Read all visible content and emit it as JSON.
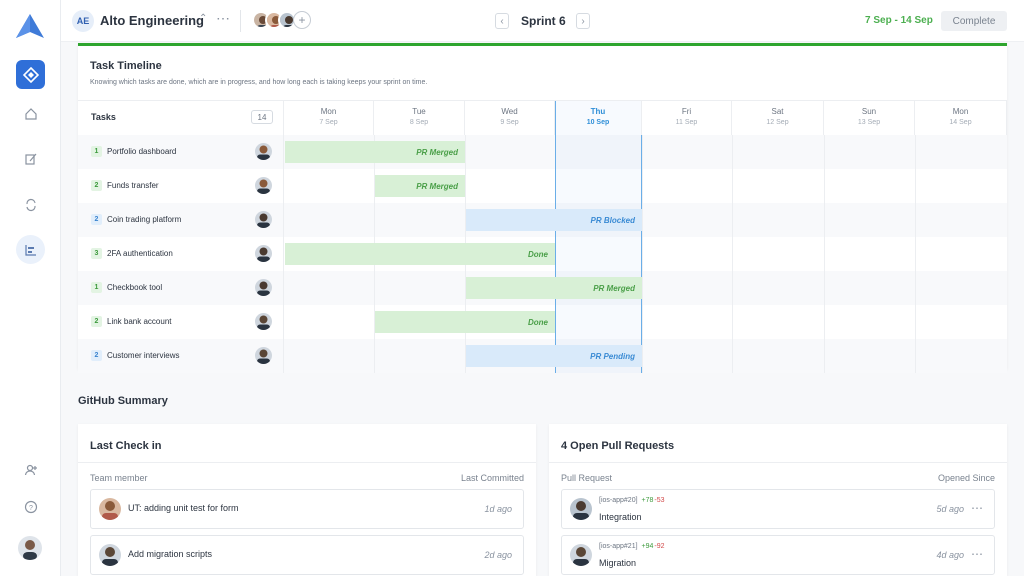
{
  "header": {
    "workspace_initials": "AE",
    "workspace_name": "Alto Engineering",
    "switch_icon": "⌃",
    "more_icon": "⋯",
    "add_member_icon": "+",
    "prev_icon": "‹",
    "next_icon": "›",
    "sprint_name": "Sprint 6",
    "date_range": "7 Sep - 14 Sep",
    "complete_label": "Complete"
  },
  "sidebar": {
    "icons": [
      "logo-icon",
      "sprint-board-icon",
      "home-icon",
      "edit-icon",
      "sync-icon",
      "timeline-icon",
      "add-user-icon",
      "help-icon",
      "user-avatar"
    ]
  },
  "timeline": {
    "title": "Task Timeline",
    "subtitle": "Knowing which tasks are done, which are in progress, and how long each is taking keeps your sprint on time.",
    "tasks_label": "Tasks",
    "task_count": "14",
    "days": [
      {
        "name": "Mon",
        "date": "7 Sep"
      },
      {
        "name": "Tue",
        "date": "8 Sep"
      },
      {
        "name": "Wed",
        "date": "9 Sep"
      },
      {
        "name": "Thu",
        "date": "10 Sep"
      },
      {
        "name": "Fri",
        "date": "11 Sep"
      },
      {
        "name": "Sat",
        "date": "12 Sep"
      },
      {
        "name": "Sun",
        "date": "13 Sep"
      },
      {
        "name": "Mon",
        "date": "14 Sep"
      }
    ],
    "tasks": [
      {
        "points": "1",
        "name": "Portfolio dashboard",
        "bar": "PR Merged",
        "status": "green"
      },
      {
        "points": "2",
        "name": "Funds transfer",
        "bar": "PR Merged",
        "status": "green"
      },
      {
        "points": "2",
        "name": "Coin trading platform",
        "bar": "PR Blocked",
        "status": "blue"
      },
      {
        "points": "3",
        "name": "2FA authentication",
        "bar": "Done",
        "status": "green"
      },
      {
        "points": "1",
        "name": "Checkbook tool",
        "bar": "PR Merged",
        "status": "green"
      },
      {
        "points": "2",
        "name": "Link bank account",
        "bar": "Done",
        "status": "green"
      },
      {
        "points": "2",
        "name": "Customer interviews",
        "bar": "PR Pending",
        "status": "blue"
      }
    ]
  },
  "github": {
    "title": "GitHub Summary",
    "checkin": {
      "title": "Last Check in",
      "col_member": "Team member",
      "col_committed": "Last Committed",
      "items": [
        {
          "text": "UT: adding unit test for form",
          "ago": "1d ago"
        },
        {
          "text": "Add migration scripts",
          "ago": "2d ago"
        }
      ]
    },
    "prs": {
      "title": "4 Open Pull Requests",
      "col_pr": "Pull Request",
      "col_since": "Opened Since",
      "items": [
        {
          "repo": "[ios-app#20]",
          "additions": "+78",
          "deletions": "-53",
          "title": "Integration",
          "ago": "5d ago",
          "more": "⋯"
        },
        {
          "repo": "[ios-app#21]",
          "additions": "+94",
          "deletions": "-92",
          "title": "Migration",
          "ago": "4d ago",
          "more": "⋯"
        }
      ]
    }
  },
  "colors": {
    "accent": "#2f6fd8",
    "done_green": "#2ea52e",
    "bar_green": "#d8f0d6",
    "bar_blue": "#d9eafa",
    "today_line": "#6aaee8"
  }
}
